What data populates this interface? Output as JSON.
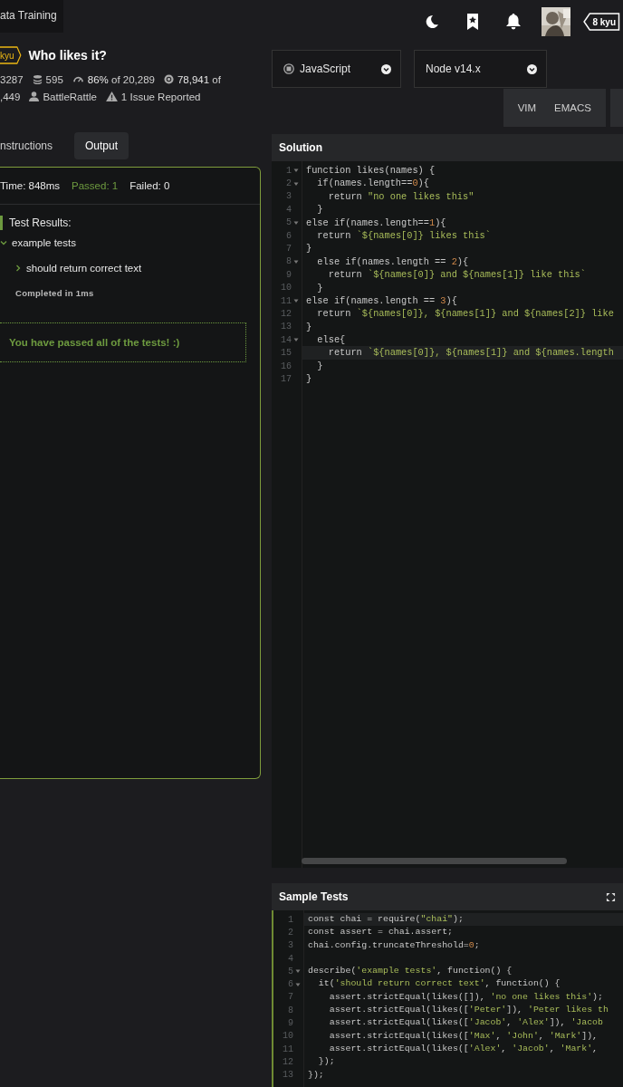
{
  "top_nav": {
    "tab": "ata Training",
    "rank_badge": "8 kyu"
  },
  "kata": {
    "rank": "kyu",
    "title": "Who likes it?",
    "stat_rows": [
      [
        {
          "kind": "plain",
          "text": "3287"
        },
        {
          "kind": "stack",
          "text": "595"
        },
        {
          "kind": "gauge",
          "text": "**86%** of 20,289"
        },
        {
          "kind": "coin",
          "text": "**78,941** of"
        }
      ],
      [
        {
          "kind": "plain",
          "text": ",449"
        },
        {
          "kind": "person",
          "text": "BattleRattle"
        },
        {
          "kind": "warning",
          "text": "1 Issue Reported"
        }
      ]
    ]
  },
  "language_select": {
    "value": "JavaScript"
  },
  "version_select": {
    "value": "Node v14.x"
  },
  "editor_modes": [
    {
      "label": "VIM",
      "selected": false
    },
    {
      "label": "EMACS",
      "selected": false
    }
  ],
  "left_tabs": [
    {
      "label": "nstructions",
      "selected": false
    },
    {
      "label": "Output",
      "selected": true
    }
  ],
  "output": {
    "time": "Time: 848ms",
    "passed": "Passed: 1",
    "failed": "Failed: 0",
    "results_heading": "Test Results:",
    "groups": [
      {
        "label": "example tests",
        "expanded": true,
        "children": [
          {
            "label": "should return correct text",
            "expanded": false
          }
        ]
      }
    ],
    "completed": "Completed in 1ms",
    "message": "You have passed all of the tests! :)"
  },
  "solution": {
    "title": "Solution",
    "lines": [
      {
        "number": "1",
        "foldable": true,
        "active": false,
        "code": "function likes(names) {"
      },
      {
        "number": "2",
        "foldable": true,
        "active": false,
        "code": "  if(names.length==0){"
      },
      {
        "number": "3",
        "foldable": false,
        "active": false,
        "code": "    return \"no one likes this\""
      },
      {
        "number": "4",
        "foldable": false,
        "active": false,
        "code": "  }"
      },
      {
        "number": "5",
        "foldable": true,
        "active": false,
        "code": "else if(names.length==1){"
      },
      {
        "number": "6",
        "foldable": false,
        "active": false,
        "code": "  return `${names[0]} likes this`"
      },
      {
        "number": "7",
        "foldable": false,
        "active": false,
        "code": "}"
      },
      {
        "number": "8",
        "foldable": true,
        "active": false,
        "code": "  else if(names.length == 2){"
      },
      {
        "number": "9",
        "foldable": false,
        "active": false,
        "code": "    return `${names[0]} and ${names[1]} like this`"
      },
      {
        "number": "10",
        "foldable": false,
        "active": false,
        "code": "  }"
      },
      {
        "number": "11",
        "foldable": true,
        "active": false,
        "code": "else if(names.length == 3){"
      },
      {
        "number": "12",
        "foldable": false,
        "active": false,
        "code": "  return `${names[0]}, ${names[1]} and ${names[2]} like"
      },
      {
        "number": "13",
        "foldable": false,
        "active": false,
        "code": "}"
      },
      {
        "number": "14",
        "foldable": true,
        "active": false,
        "code": "  else{"
      },
      {
        "number": "15",
        "foldable": false,
        "active": true,
        "code": "    return `${names[0]}, ${names[1]} and ${names.length"
      },
      {
        "number": "16",
        "foldable": false,
        "active": false,
        "code": "  }"
      },
      {
        "number": "17",
        "foldable": false,
        "active": false,
        "code": "}"
      }
    ]
  },
  "sample_tests": {
    "title": "Sample Tests",
    "lines": [
      {
        "number": "1",
        "foldable": false,
        "active": true,
        "code": "const chai = require(\"chai\");"
      },
      {
        "number": "2",
        "foldable": false,
        "active": false,
        "code": "const assert = chai.assert;"
      },
      {
        "number": "3",
        "foldable": false,
        "active": false,
        "code": "chai.config.truncateThreshold=0;"
      },
      {
        "number": "4",
        "foldable": false,
        "active": false
      },
      {
        "number": "5",
        "foldable": true,
        "active": false,
        "code": "describe('example tests', function() {"
      },
      {
        "number": "6",
        "foldable": true,
        "active": false,
        "code": "  it('should return correct text', function() {"
      },
      {
        "number": "7",
        "foldable": false,
        "active": false,
        "code": "    assert.strictEqual(likes([]), 'no one likes this');"
      },
      {
        "number": "8",
        "foldable": false,
        "active": false,
        "code": "    assert.strictEqual(likes(['Peter']), 'Peter likes th"
      },
      {
        "number": "9",
        "foldable": false,
        "active": false,
        "code": "    assert.strictEqual(likes(['Jacob', 'Alex']), 'Jacob"
      },
      {
        "number": "10",
        "foldable": false,
        "active": false,
        "code": "    assert.strictEqual(likes(['Max', 'John', 'Mark']),"
      },
      {
        "number": "11",
        "foldable": false,
        "active": false,
        "code": "    assert.strictEqual(likes(['Alex', 'Jacob', 'Mark',"
      },
      {
        "number": "12",
        "foldable": false,
        "active": false,
        "code": "  });"
      },
      {
        "number": "13",
        "foldable": false,
        "active": false,
        "code": "});"
      }
    ]
  }
}
